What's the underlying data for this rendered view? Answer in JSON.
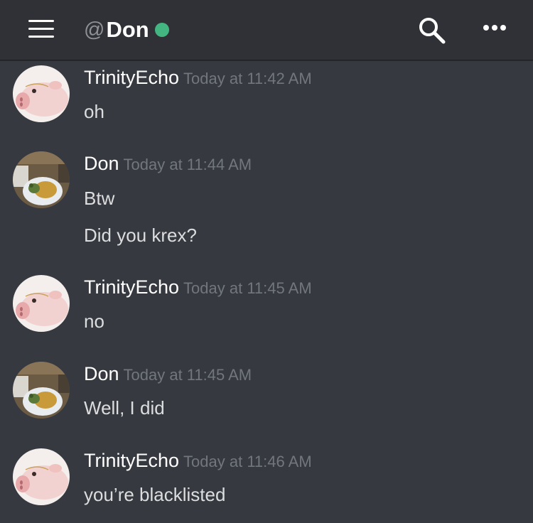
{
  "header": {
    "at": "@",
    "channel_name": "Don",
    "status_color": "#43b581",
    "menu_icon": "hamburger-menu-icon",
    "search_icon": "search-icon",
    "more_icon": "more-horizontal-icon"
  },
  "messages": [
    {
      "author": "TrinityEcho",
      "timestamp": "Today at 11:42 AM",
      "avatar": "pig-avatar",
      "lines": [
        "oh"
      ]
    },
    {
      "author": "Don",
      "timestamp": "Today at 11:44 AM",
      "avatar": "food-plate-avatar",
      "lines": [
        "Btw",
        "Did you krex?"
      ]
    },
    {
      "author": "TrinityEcho",
      "timestamp": "Today at 11:45 AM",
      "avatar": "pig-avatar",
      "lines": [
        "no"
      ]
    },
    {
      "author": "Don",
      "timestamp": "Today at 11:45 AM",
      "avatar": "food-plate-avatar",
      "lines": [
        "Well, I did"
      ]
    },
    {
      "author": "TrinityEcho",
      "timestamp": "Today at 11:46 AM",
      "avatar": "pig-avatar",
      "lines": [
        "you’re blacklisted"
      ]
    }
  ]
}
